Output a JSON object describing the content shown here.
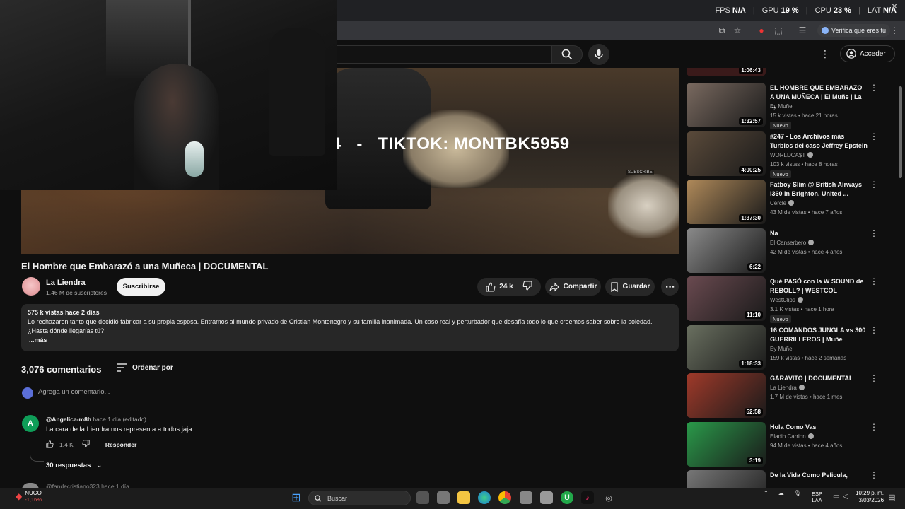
{
  "browser": {
    "perf": [
      {
        "label": "FPS",
        "value": "N/A"
      },
      {
        "label": "GPU",
        "value": "19 %"
      },
      {
        "label": "CPU",
        "value": "23 %"
      },
      {
        "label": "LAT",
        "value": "N/A"
      }
    ],
    "verify_label": "Verifica que eres tú"
  },
  "header": {
    "signin_label": "Acceder"
  },
  "player": {
    "overlay_text": "INSTAGRAM: CRISSMONTE94   -   TIKTOK: MONTBK5959",
    "watermark": "SUBSCRIBE"
  },
  "video": {
    "title": "El Hombre que Embarazó a una Muñeca | DOCUMENTAL",
    "channel": "La Liendra",
    "subscribers": "1.46 M de suscriptores",
    "subscribe_label": "Suscribirse",
    "likes": "24 k",
    "share_label": "Compartir",
    "save_label": "Guardar",
    "description": {
      "meta": "575 k vistas  hace 2 días",
      "text": "Lo rechazaron tanto que decidió fabricar a su propia esposa.  Entramos al mundo privado de Cristian Montenegro y su familia inanimada. Un caso real y perturbador que desafía todo lo que creemos saber sobre la soledad. ¿Hasta dónde llegarías tú?",
      "more": "...más"
    }
  },
  "comments": {
    "count": "3,076 comentarios",
    "sort_label": "Ordenar por",
    "add_placeholder": "Agrega un comentario...",
    "first": {
      "avatar_letter": "A",
      "user": "@Angelica-m8h",
      "time": "hace 1 día (editado)",
      "text": "La cara de la Liendra nos representa a todos jaja",
      "likes": "1.4 K",
      "reply_label": "Responder",
      "replies": "30 respuestas"
    },
    "second": {
      "user": "@fandecristiano323",
      "time": "hace 1 día"
    }
  },
  "sidebar": {
    "top_duration": "1:06:43",
    "items": [
      {
        "title": "EL HOMBRE QUE EMBARAZO A UNA MUÑECA | El Muñe | La ...",
        "channel": "Ey Muñe",
        "verified": false,
        "meta": "15 k vistas • hace 21 horas",
        "badge": "Nuevo",
        "duration": "1:32:57",
        "thumb_color": "#7a6a60"
      },
      {
        "title": "#247 - Los Archivos más Turbios del caso Jeffrey Epstein",
        "channel": "WORLDCA$T",
        "verified": true,
        "meta": "103 k vistas • hace 8 horas",
        "badge": "Nuevo",
        "duration": "4:00:25",
        "thumb_color": "#5a4a3a"
      },
      {
        "title": "Fatboy Slim @ British Airways i360 in Brighton, United ...",
        "channel": "Cercle",
        "verified": true,
        "meta": "43 M de vistas • hace 7 años",
        "badge": "",
        "duration": "1:37:30",
        "thumb_color": "#b08a5a"
      },
      {
        "title": "Na",
        "channel": "El Canserbero",
        "verified": true,
        "meta": "42 M de vistas • hace 4 años",
        "badge": "",
        "duration": "6:22",
        "thumb_color": "#8a8a8a"
      },
      {
        "title": "Qué PASÓ con la W SOUND de REBOLL? | WESTCOL",
        "channel": "WestClips",
        "verified": true,
        "meta": "3.1 K vistas • hace 1 hora",
        "badge": "Nuevo",
        "duration": "11:10",
        "thumb_color": "#6a4a50"
      },
      {
        "title": "16 COMANDOS JUNGLA vs 300 GUERRILLEROS | Muñe",
        "channel": "Ey Muñe",
        "verified": false,
        "meta": "159 k vistas • hace 2 semanas",
        "badge": "",
        "duration": "1:18:33",
        "thumb_color": "#6a7060"
      },
      {
        "title": "GARAVITO | DOCUMENTAL",
        "channel": "La Liendra",
        "verified": true,
        "meta": "1.7 M de vistas • hace 1 mes",
        "badge": "",
        "duration": "52:58",
        "thumb_color": "#a03a2a"
      },
      {
        "title": "Hola Como Vas",
        "channel": "Eladio Carrion",
        "verified": true,
        "meta": "94 M de vistas • hace 4 años",
        "badge": "",
        "duration": "3:19",
        "thumb_color": "#2a9a4a"
      },
      {
        "title": "De la Vida Como Pelicula,",
        "channel": "",
        "verified": false,
        "meta": "",
        "badge": "",
        "duration": "",
        "thumb_color": "#777777"
      }
    ]
  },
  "taskbar": {
    "weather_name": "NUCO",
    "weather_change": "-1,16%",
    "search_placeholder": "Buscar",
    "lang_1": "ESP",
    "lang_2": "LAA",
    "time": "10:29 p. m.",
    "date": "3/03/2026"
  }
}
